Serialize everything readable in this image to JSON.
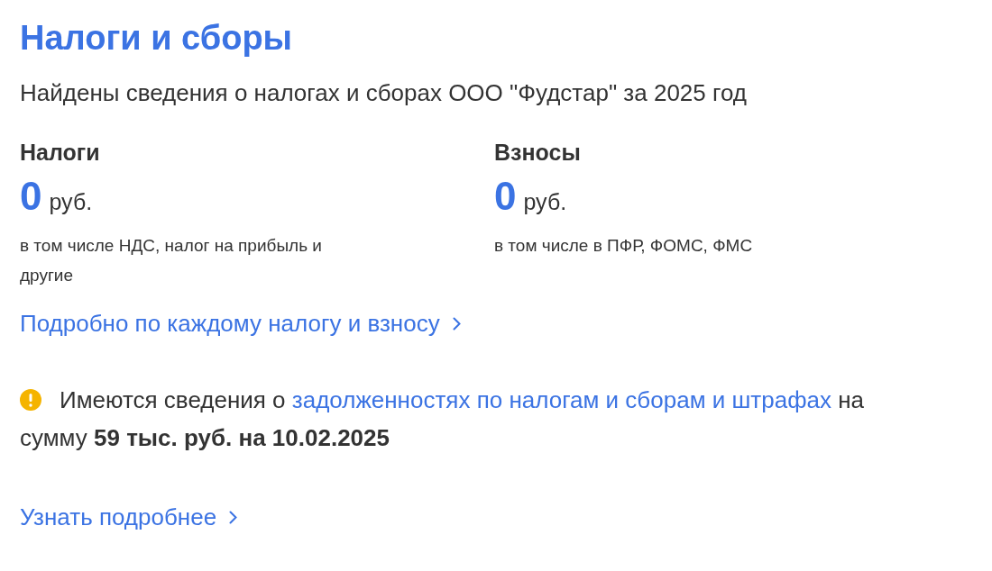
{
  "title": "Налоги и сборы",
  "subtitle": "Найдены сведения о налогах и сборах ООО \"Фудстар\" за 2025 год",
  "summary": [
    {
      "heading": "Налоги",
      "amount": "0",
      "unit": "руб.",
      "note": "в том числе НДС, налог на прибыль и другие"
    },
    {
      "heading": "Взносы",
      "amount": "0",
      "unit": "руб.",
      "note": "в том числе в ПФР, ФОМС, ФМС"
    }
  ],
  "details_link": "Подробно по каждому налогу и взносу",
  "notice": {
    "before": "Имеются сведения о",
    "link": "задолженностях по налогам и сборам и штрафах",
    "after": "на сумму **59 тыс. руб. на 10.02.2025**"
  },
  "more_link": "Узнать подробнее"
}
